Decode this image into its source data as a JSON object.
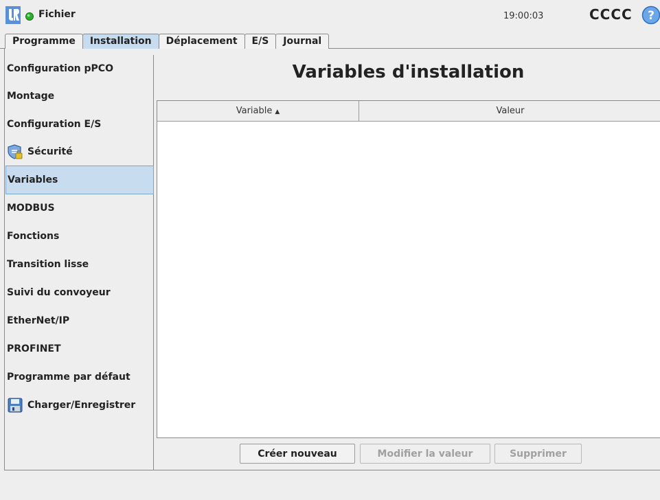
{
  "titlebar": {
    "file_menu": "Fichier",
    "time": "19:00:03",
    "robot_name": "CCCC",
    "icons": [
      "ur-logo-icon",
      "status-dot-icon",
      "help-icon"
    ],
    "colors": {
      "status": "#2fae2f",
      "accent": "#3b7fd1"
    }
  },
  "tabs": [
    {
      "label": "Programme"
    },
    {
      "label": "Installation"
    },
    {
      "label": "Déplacement"
    },
    {
      "label": "E/S"
    },
    {
      "label": "Journal"
    }
  ],
  "active_tab": "Installation",
  "sidebar": {
    "items": [
      {
        "label": "Configuration pPCO"
      },
      {
        "label": "Montage"
      },
      {
        "label": "Configuration E/S"
      },
      {
        "label": "Sécurité",
        "icon": "shield-lock-icon"
      },
      {
        "label": "Variables"
      },
      {
        "label": "MODBUS"
      },
      {
        "label": "Fonctions"
      },
      {
        "label": "Transition lisse"
      },
      {
        "label": "Suivi du convoyeur"
      },
      {
        "label": "EtherNet/IP"
      },
      {
        "label": "PROFINET"
      },
      {
        "label": "Programme par défaut"
      },
      {
        "label": "Charger/Enregistrer",
        "icon": "floppy-disk-icon"
      }
    ],
    "selected": "Variables"
  },
  "main": {
    "title": "Variables d'installation",
    "table": {
      "columns": [
        "Variable",
        "Valeur"
      ],
      "sort_indicator": "▲",
      "rows": []
    },
    "buttons": {
      "create": "Créer nouveau",
      "edit": "Modifier la valeur",
      "delete": "Supprimer"
    }
  }
}
